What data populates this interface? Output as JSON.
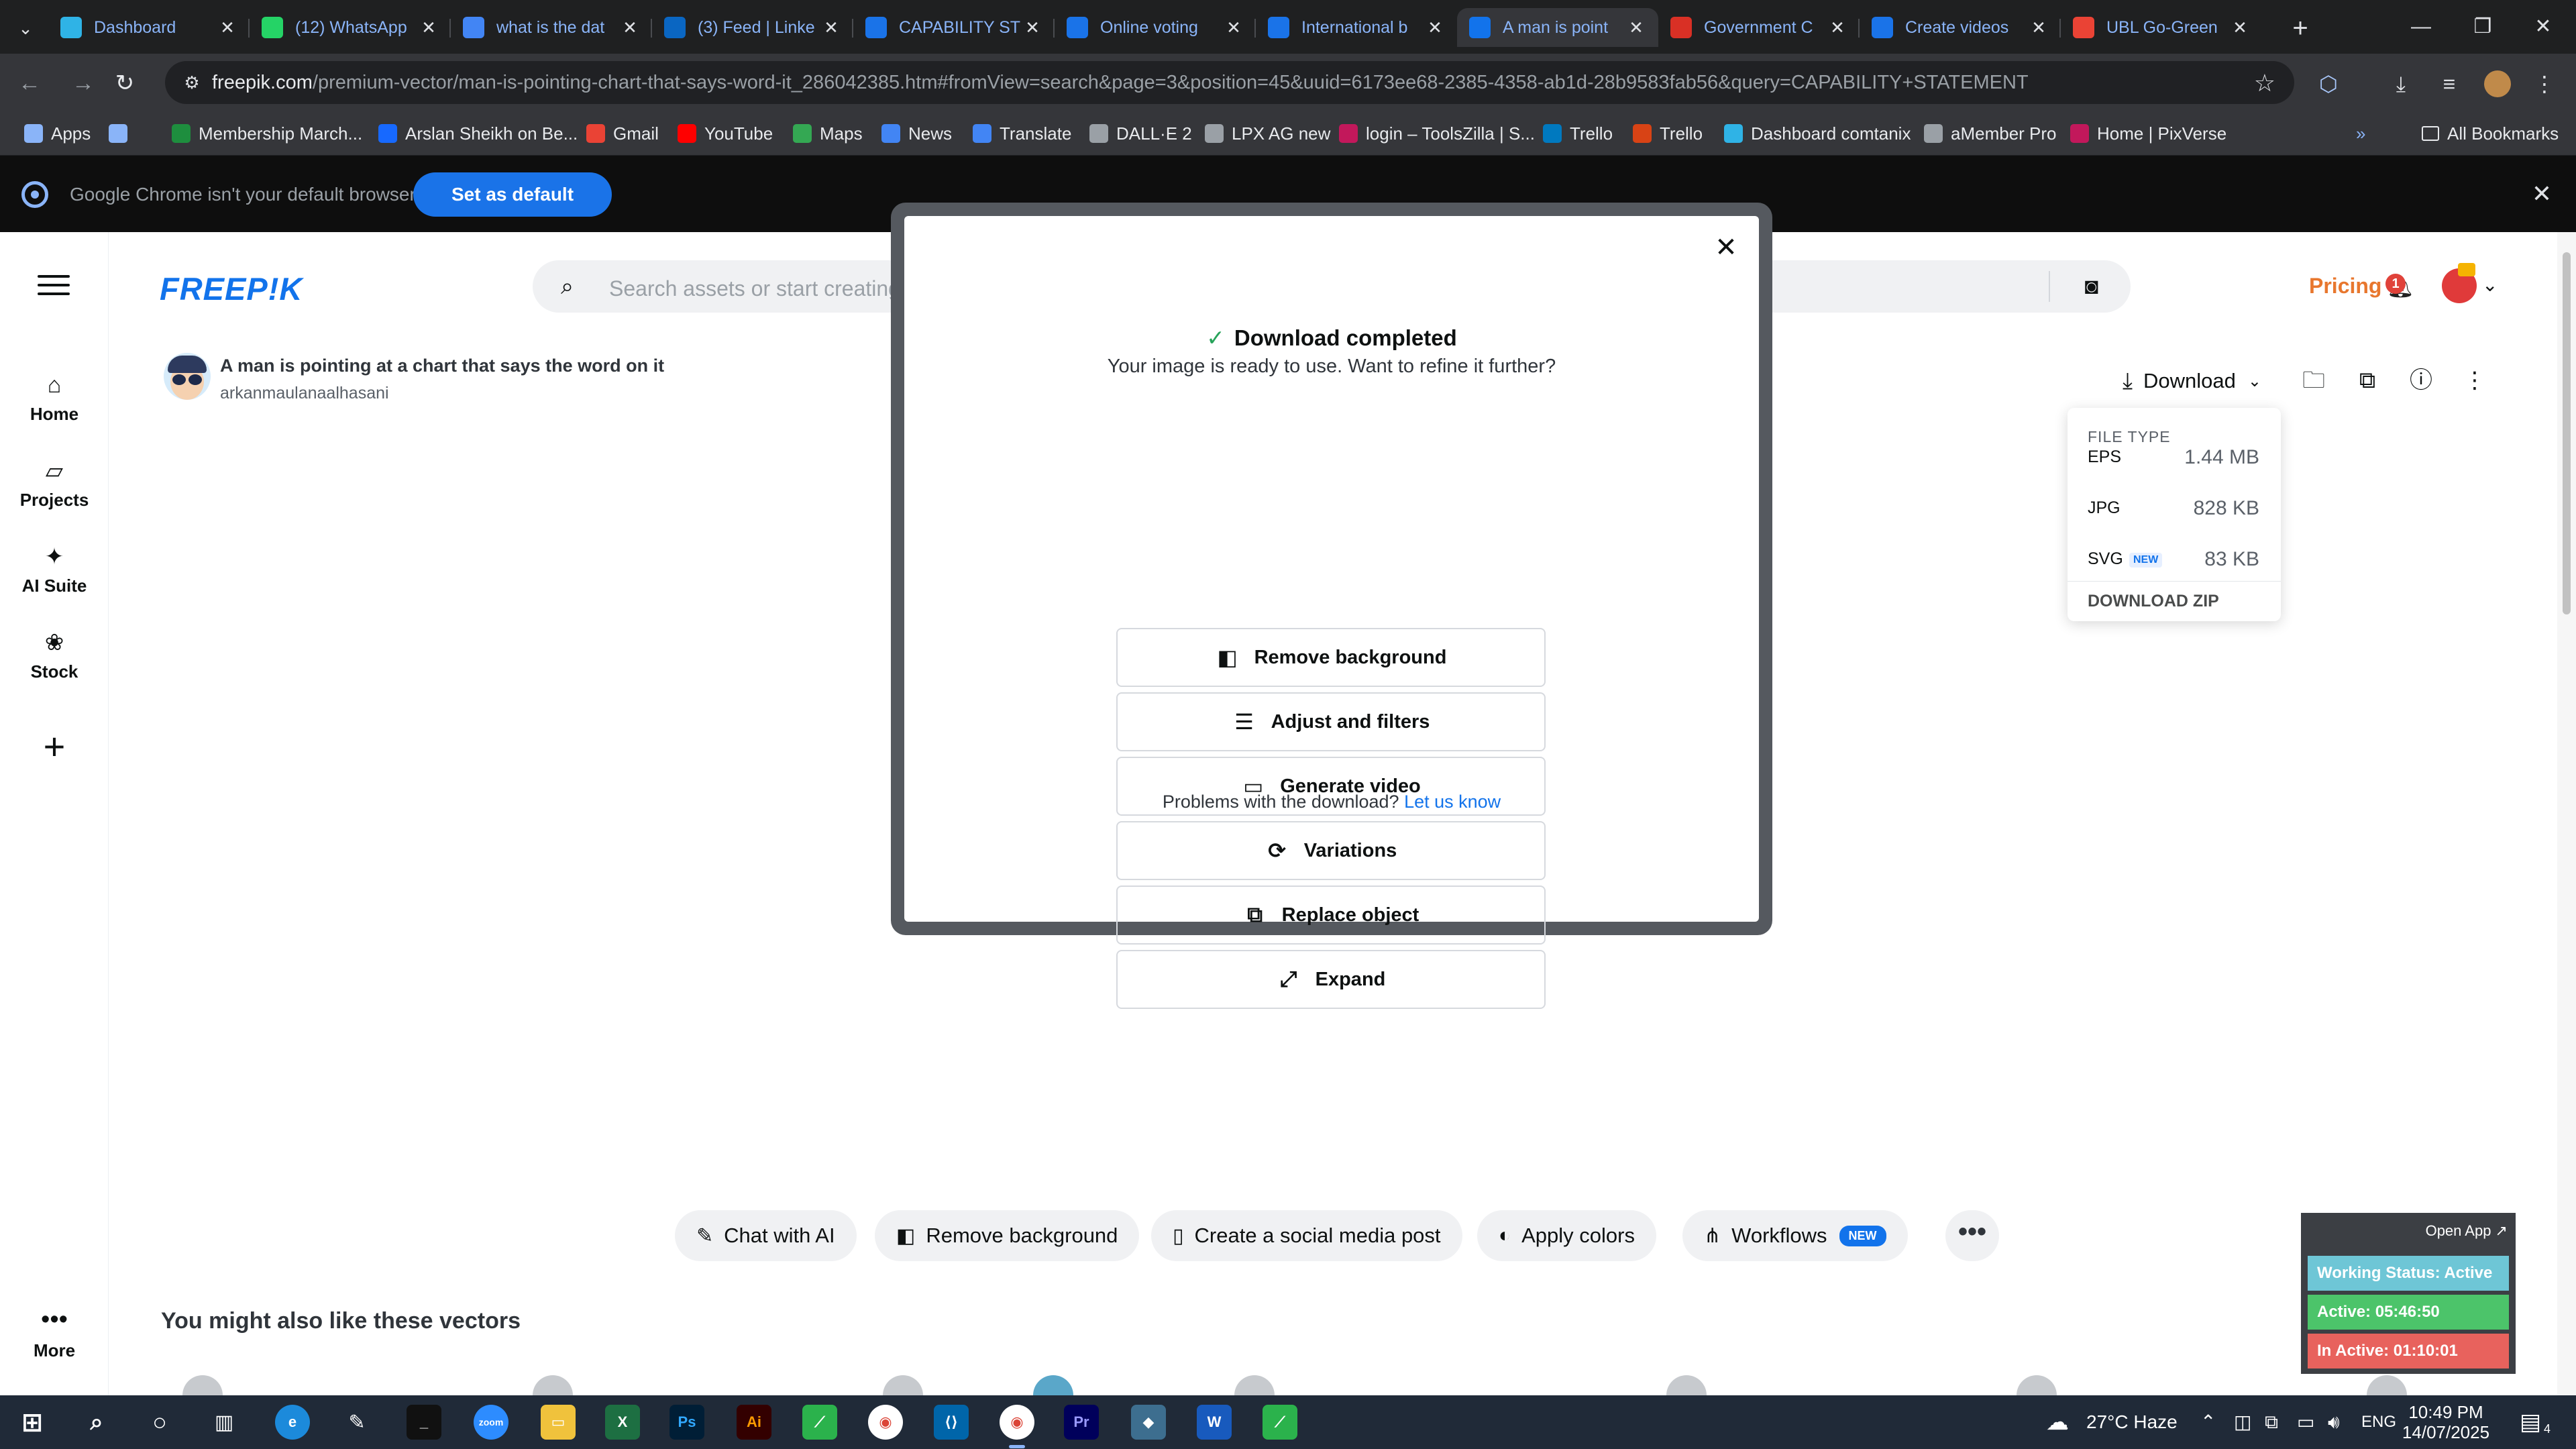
{
  "browser": {
    "tabs": [
      {
        "title": "Dashboard",
        "icon": "dashboard-favicon",
        "color": "#2fb3e6",
        "active": false
      },
      {
        "title": "(12) WhatsApp",
        "icon": "whatsapp-favicon",
        "color": "#25d366",
        "active": false
      },
      {
        "title": "what is the dat",
        "icon": "google-favicon",
        "color": "#4285f4",
        "active": false
      },
      {
        "title": "(3) Feed | Linke",
        "icon": "linkedin-favicon",
        "color": "#0a66c2",
        "active": false
      },
      {
        "title": "CAPABILITY ST",
        "icon": "docs-favicon",
        "color": "#1a73e8",
        "active": false
      },
      {
        "title": "Online voting",
        "icon": "docs-favicon",
        "color": "#1a73e8",
        "active": false
      },
      {
        "title": "International b",
        "icon": "docs-favicon",
        "color": "#1a73e8",
        "active": false
      },
      {
        "title": "A man is point",
        "icon": "freepik-favicon",
        "color": "#1273eb",
        "active": true
      },
      {
        "title": "Government C",
        "icon": "gem-favicon",
        "color": "#d93025",
        "active": false
      },
      {
        "title": "Create videos",
        "icon": "docs-favicon",
        "color": "#1a73e8",
        "active": false
      },
      {
        "title": "UBL Go-Green",
        "icon": "gmail-favicon",
        "color": "#ea4335",
        "active": false
      }
    ],
    "url_domain": "freepik.com",
    "url_path": "/premium-vector/man-is-pointing-chart-that-says-word-it_286042385.htm#fromView=search&page=3&position=45&uuid=6173ee68-2385-4358-ab1d-28b9583fab56&query=CAPABILITY+STATEMENT",
    "bookmarks": [
      {
        "label": "Apps",
        "icon": "apps-grid-icon",
        "color": "#8ab4f8"
      },
      {
        "label": "",
        "icon": "grid-icon",
        "color": "#8ab4f8"
      },
      {
        "label": "Membership March...",
        "icon": "green-plus-icon",
        "color": "#1e8e3e"
      },
      {
        "label": "Arslan Sheikh on Be...",
        "icon": "behance-icon",
        "color": "#1769ff"
      },
      {
        "label": "Gmail",
        "icon": "gmail-icon",
        "color": "#ea4335"
      },
      {
        "label": "YouTube",
        "icon": "youtube-icon",
        "color": "#ff0000"
      },
      {
        "label": "Maps",
        "icon": "maps-icon",
        "color": "#34a853"
      },
      {
        "label": "News",
        "icon": "news-icon",
        "color": "#4285f4"
      },
      {
        "label": "Translate",
        "icon": "translate-icon",
        "color": "#4285f4"
      },
      {
        "label": "DALL·E 2",
        "icon": "openai-icon",
        "color": "#9aa0a6"
      },
      {
        "label": "LPX AG new",
        "icon": "dash-icon",
        "color": "#9aa0a6"
      },
      {
        "label": "login – ToolsZilla | S...",
        "icon": "toolszilla-icon",
        "color": "#c2185b"
      },
      {
        "label": "Trello",
        "icon": "trello-icon",
        "color": "#0079bf"
      },
      {
        "label": "Trello",
        "icon": "trello-icon",
        "color": "#d84315"
      },
      {
        "label": "Dashboard comtanix",
        "icon": "comtanix-icon",
        "color": "#2fb3e6"
      },
      {
        "label": "aMember Pro",
        "icon": "amember-icon",
        "color": "#9aa0a6"
      },
      {
        "label": "Home | PixVerse",
        "icon": "pixverse-icon",
        "color": "#c2185b"
      }
    ],
    "all_bookmarks_label": "All Bookmarks",
    "infobar": {
      "text": "Google Chrome isn't your default browser",
      "button": "Set as default"
    }
  },
  "freepik": {
    "logo": "FREEP!K",
    "search_placeholder": "Search assets or start creating",
    "pricing": "Pricing",
    "notification_count": "1",
    "nav": [
      {
        "label": "Home",
        "icon": "home-icon"
      },
      {
        "label": "Projects",
        "icon": "projects-icon"
      },
      {
        "label": "AI Suite",
        "icon": "ai-suite-icon"
      },
      {
        "label": "Stock",
        "icon": "stock-icon"
      }
    ],
    "nav_more": "More",
    "asset": {
      "title": "A man is pointing at a chart that says the word on it",
      "author": "arkanmaulanaalhasani"
    },
    "download_label": "Download",
    "file_menu": {
      "header": "FILE TYPE",
      "items": [
        {
          "type": "EPS",
          "size": "1.44 MB",
          "badge": ""
        },
        {
          "type": "JPG",
          "size": "828 KB",
          "badge": ""
        },
        {
          "type": "SVG",
          "size": "83 KB",
          "badge": "NEW"
        }
      ],
      "zip": "DOWNLOAD ZIP"
    },
    "modal": {
      "title": "Download completed",
      "subtitle": "Your image is ready to use. Want to refine it further?",
      "buttons": [
        {
          "label": "Remove background",
          "icon": "remove-bg-icon"
        },
        {
          "label": "Adjust and filters",
          "icon": "sliders-icon"
        },
        {
          "label": "Generate video",
          "icon": "video-camera-icon"
        },
        {
          "label": "Variations",
          "icon": "refresh-icon"
        },
        {
          "label": "Replace object",
          "icon": "replace-object-icon"
        },
        {
          "label": "Expand",
          "icon": "expand-icon"
        }
      ],
      "problem_text": "Problems with the download?",
      "problem_link": "Let us know"
    },
    "tools": [
      {
        "label": "Chat with AI",
        "icon": "chat-ai-icon",
        "badge": ""
      },
      {
        "label": "Remove background",
        "icon": "remove-bg-icon",
        "badge": ""
      },
      {
        "label": "Create a social media post",
        "icon": "phone-icon",
        "badge": ""
      },
      {
        "label": "Apply colors",
        "icon": "palette-icon",
        "badge": ""
      },
      {
        "label": "Workflows",
        "icon": "workflows-icon",
        "badge": "NEW"
      }
    ],
    "also_like": "You might also like these vectors"
  },
  "tracker": {
    "open_app": "Open App ↗",
    "working_status": "Working Status: Active",
    "active": "Active: 05:46:50",
    "inactive": "In Active: 01:10:01",
    "colors": {
      "status": "#6ec6d6",
      "active": "#4cc46a",
      "inactive": "#e8625d"
    }
  },
  "taskbar": {
    "weather": "27°C  Haze",
    "language": "ENG",
    "time": "10:49 PM",
    "date": "14/07/2025",
    "notification_count": "4"
  }
}
